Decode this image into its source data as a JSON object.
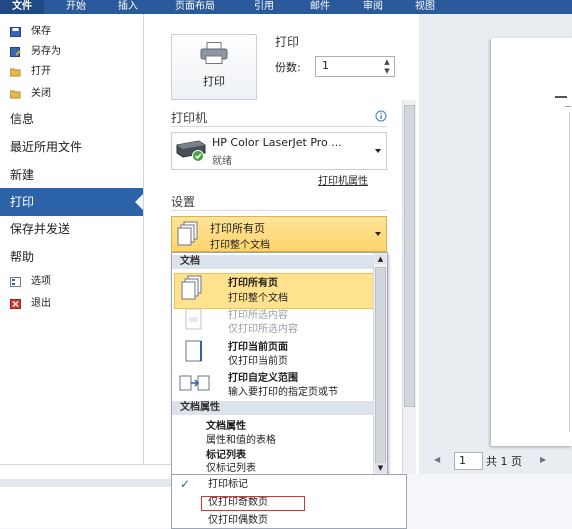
{
  "ribbon": {
    "tabs": [
      "文件",
      "开始",
      "插入",
      "页面布局",
      "引用",
      "邮件",
      "审阅",
      "视图"
    ]
  },
  "nav": {
    "save": "保存",
    "save_as": "另存为",
    "open": "打开",
    "close": "关闭",
    "info": "信息",
    "recent": "最近所用文件",
    "new": "新建",
    "print": "打印",
    "save_send": "保存并发送",
    "help": "帮助",
    "options": "选项",
    "exit": "退出"
  },
  "print": {
    "button_label": "打印",
    "section_title": "打印",
    "copies_label": "份数:",
    "copies_value": "1"
  },
  "printer": {
    "section_title": "打印机",
    "name": "HP Color LaserJet Pro ...",
    "status": "就绪",
    "properties_link": "打印机属性"
  },
  "settings": {
    "section_title": "设置",
    "selected_title": "打印所有页",
    "selected_sub": "打印整个文档"
  },
  "dropdown": {
    "group_document": "文档",
    "options": [
      {
        "title": "打印所有页",
        "sub": "打印整个文档"
      },
      {
        "title": "打印所选内容",
        "sub": "仅打印所选内容"
      },
      {
        "title": "打印当前页面",
        "sub": "仅打印当前页"
      },
      {
        "title": "打印自定义范围",
        "sub": "输入要打印的指定页或节"
      }
    ],
    "group_properties": "文档属性",
    "properties": [
      {
        "title": "文档属性",
        "sub": "属性和值的表格"
      },
      {
        "title": "标记列表",
        "sub": "仅标记列表"
      }
    ]
  },
  "popup": {
    "print_markup": "打印标记",
    "odd_pages": "仅打印奇数页",
    "even_pages": "仅打印偶数页"
  },
  "pager": {
    "current": "1",
    "total": "共 1 页"
  },
  "colors": {
    "ribbon": "#2a5a9b",
    "accent_selected": "#2c63a8",
    "highlight": "#ffe28e",
    "odd_pages_outline": "#e03030"
  }
}
